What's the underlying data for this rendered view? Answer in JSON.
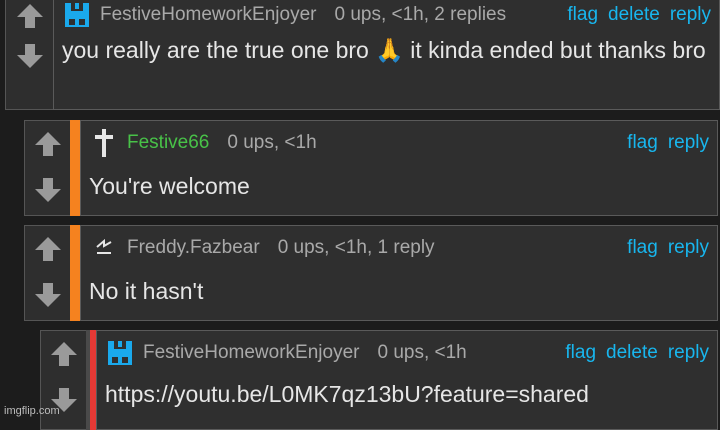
{
  "comments": [
    {
      "username": "FestiveHomeworkEnjoyer",
      "stats": "0 ups, <1h, 2 replies",
      "actions": [
        "flag",
        "delete",
        "reply"
      ],
      "text": "you really are the true one bro 🙏 it kinda ended but thanks bro",
      "avatar_icon": "blue-pixel-icon"
    },
    {
      "username": "Festive66",
      "stats": "0 ups, <1h",
      "actions": [
        "flag",
        "reply"
      ],
      "text": "You're welcome",
      "avatar_icon": "cross-icon",
      "username_color": "#48c248",
      "stripe_color": "#f5821f"
    },
    {
      "username": "Freddy.Fazbear",
      "stats": "0 ups, <1h, 1 reply",
      "actions": [
        "flag",
        "reply"
      ],
      "text": "No it hasn't",
      "avatar_icon": "lightning-icon",
      "stripe_color": "#f5821f"
    },
    {
      "username": "FestiveHomeworkEnjoyer",
      "stats": "0 ups, <1h",
      "actions": [
        "flag",
        "delete",
        "reply"
      ],
      "text": "https://youtu.be/L0MK7qz13bU?feature=shared",
      "avatar_icon": "blue-pixel-icon",
      "stripe_color": "#e53935"
    }
  ],
  "watermark": "imgflip.com",
  "colors": {
    "background": "#1c1c1c",
    "box": "#2f2f2f",
    "link": "#18b6ee",
    "avatar_blue": "#1aa9ec"
  }
}
